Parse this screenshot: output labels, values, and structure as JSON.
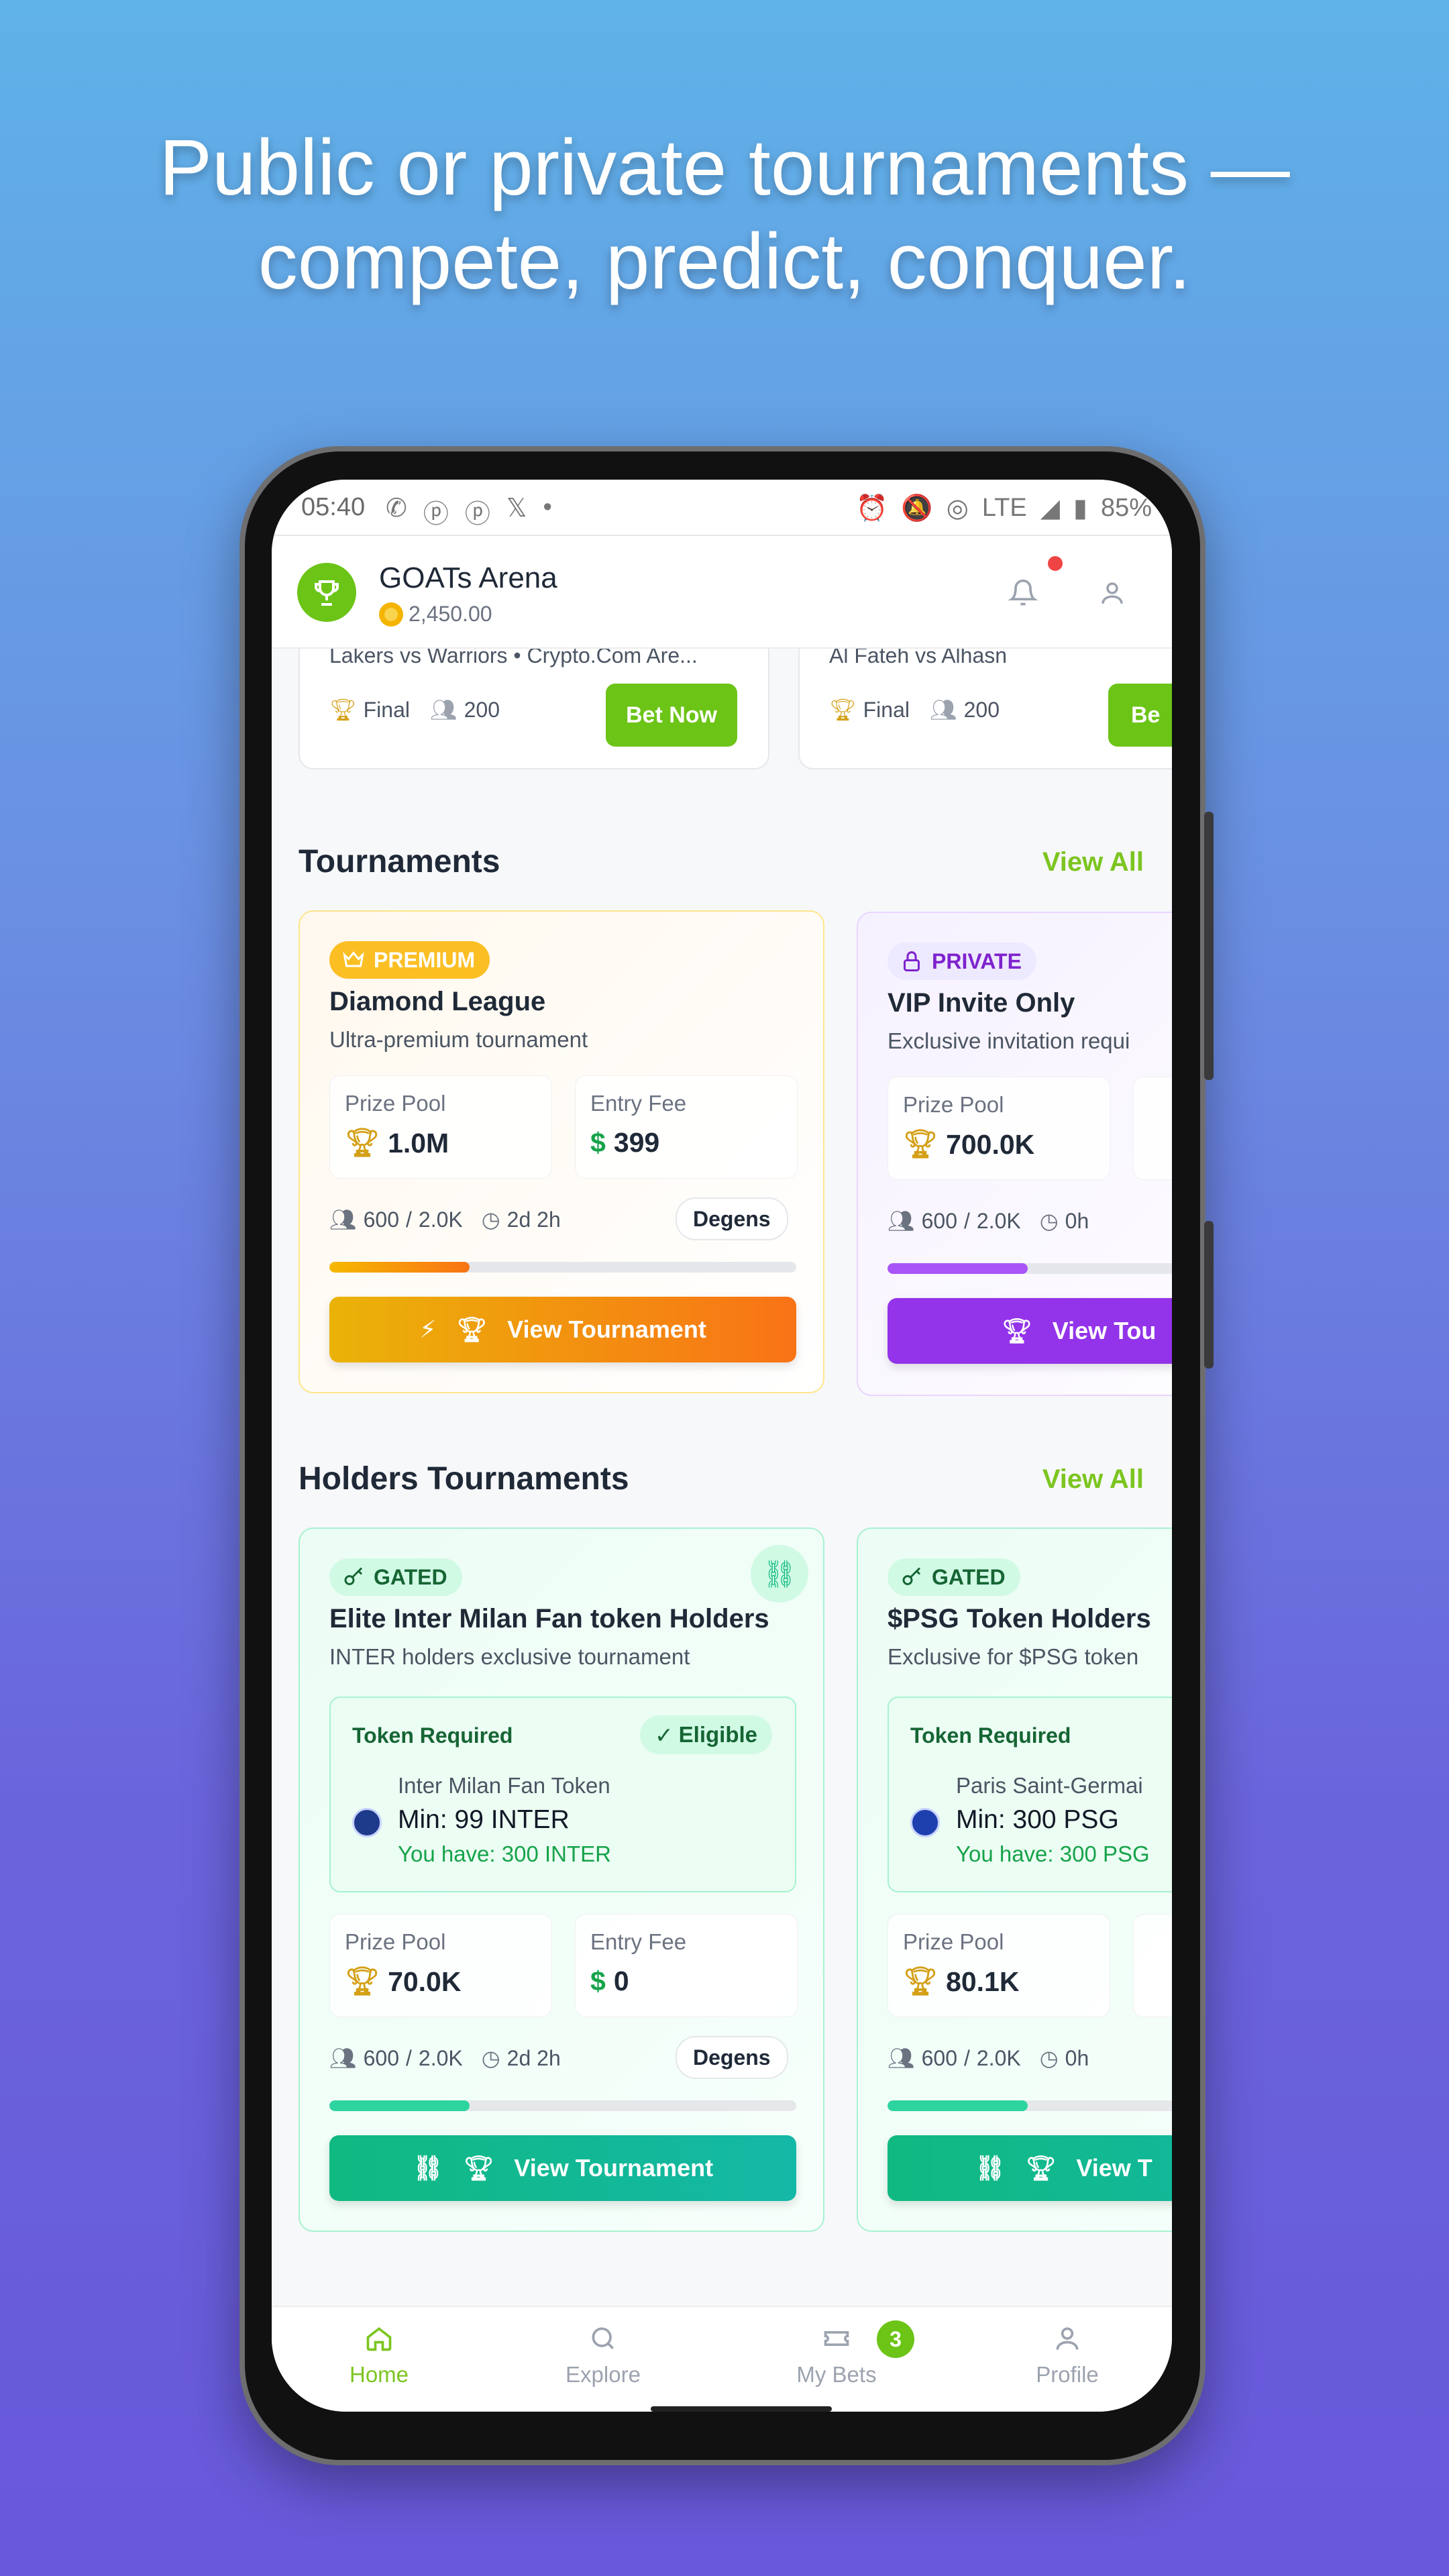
{
  "headline": {
    "line1": "Public or private tournaments —",
    "line2": "compete, predict, conquer."
  },
  "status_bar": {
    "time": "05:40",
    "network": "LTE",
    "battery": "85%"
  },
  "app": {
    "title": "GOATs Arena",
    "balance": "2,450.00"
  },
  "matches": [
    {
      "subtitle": "Lakers vs Warriors • Crypto.Com Are...",
      "stage": "Final",
      "participants": "200",
      "bet_label": "Bet Now"
    },
    {
      "subtitle": "Al Fateh vs Alhasn",
      "stage": "Final",
      "participants": "200",
      "bet_label": "Be"
    }
  ],
  "tournaments": {
    "title": "Tournaments",
    "view_all": "View All",
    "items": [
      {
        "badge": "PREMIUM",
        "name": "Diamond League",
        "description": "Ultra-premium tournament",
        "prize_label": "Prize Pool",
        "prize_value": "1.0M",
        "fee_label": "Entry Fee",
        "fee_value": "399",
        "players": "600",
        "max_players": "2.0K",
        "time_left": "2d 2h",
        "tier": "Degens",
        "progress": 0.3,
        "cta": "View Tournament"
      },
      {
        "badge": "PRIVATE",
        "name": "VIP Invite Only",
        "description": "Exclusive invitation requi",
        "prize_label": "Prize Pool",
        "prize_value": "700.0K",
        "players": "600",
        "max_players": "2.0K",
        "time_left": "0h",
        "progress": 0.3,
        "cta": "View Tou"
      }
    ]
  },
  "holders": {
    "title": "Holders Tournaments",
    "view_all": "View All",
    "items": [
      {
        "badge": "GATED",
        "name": "Elite Inter Milan Fan token Holders",
        "description": "INTER holders exclusive tournament",
        "token_required": "Token Required",
        "eligible": "Eligible",
        "token_name": "Inter Milan Fan Token",
        "token_min": "Min: 99 INTER",
        "token_have": "You have: 300 INTER",
        "prize_label": "Prize Pool",
        "prize_value": "70.0K",
        "fee_label": "Entry Fee",
        "fee_value": "0",
        "players": "600",
        "max_players": "2.0K",
        "time_left": "2d 2h",
        "tier": "Degens",
        "progress": 0.3,
        "cta": "View Tournament"
      },
      {
        "badge": "GATED",
        "name": "$PSG Token Holders",
        "description": "Exclusive for $PSG token",
        "token_required": "Token Required",
        "token_name": "Paris Saint-Germai",
        "token_min": "Min: 300 PSG",
        "token_have": "You have: 300 PSG",
        "prize_label": "Prize Pool",
        "prize_value": "80.1K",
        "players": "600",
        "max_players": "2.0K",
        "time_left": "0h",
        "progress": 0.3,
        "cta": "View T"
      }
    ]
  },
  "bottom_nav": {
    "items": [
      "Home",
      "Explore",
      "My Bets",
      "Profile"
    ],
    "bets_badge": "3",
    "active": "Home"
  },
  "colors": {
    "accent_green": "#6cc417",
    "premium_orange": "#f97316",
    "private_purple": "#9333ea",
    "gated_teal": "#10b981"
  }
}
